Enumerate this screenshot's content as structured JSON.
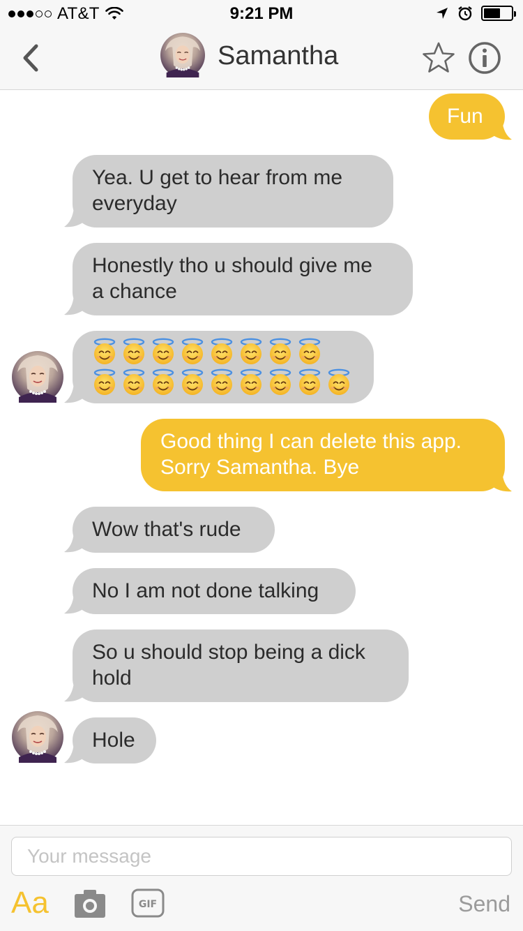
{
  "status_bar": {
    "carrier": "AT&T",
    "time": "9:21 PM",
    "signal_bars_filled": 3,
    "signal_bars_total": 5,
    "battery_level": 0.6
  },
  "header": {
    "back_icon": "chevron-left-icon",
    "contact_name": "Samantha",
    "star_icon": "star-outline-icon",
    "info_icon": "info-circle-icon"
  },
  "messages": [
    {
      "direction": "out",
      "text": "Fun"
    },
    {
      "direction": "in",
      "lines": [
        "Yea.   U get to hear from me",
        "everyday"
      ]
    },
    {
      "direction": "in",
      "lines": [
        "Honestly tho u should give me",
        "a chance"
      ]
    },
    {
      "direction": "in",
      "emoji": "smiling-face-with-halo-icon",
      "emoji_rows": [
        8,
        9
      ]
    },
    {
      "direction": "out",
      "lines": [
        "Good thing I can delete this app.",
        "Sorry Samantha. Bye"
      ]
    },
    {
      "direction": "in",
      "text": "Wow that's rude"
    },
    {
      "direction": "in",
      "text": "No I am not done talking"
    },
    {
      "direction": "in",
      "lines": [
        "So u should stop being a dick",
        "hold"
      ]
    },
    {
      "direction": "in",
      "text": "Hole"
    }
  ],
  "composer": {
    "placeholder": "Your message",
    "format_label": "Aa",
    "camera_icon": "camera-icon",
    "gif_label": "GIF",
    "send_label": "Send"
  },
  "colors": {
    "accent": "#f5c230",
    "incoming_bubble": "#cfcfcf",
    "header_bg": "#f7f7f7"
  }
}
